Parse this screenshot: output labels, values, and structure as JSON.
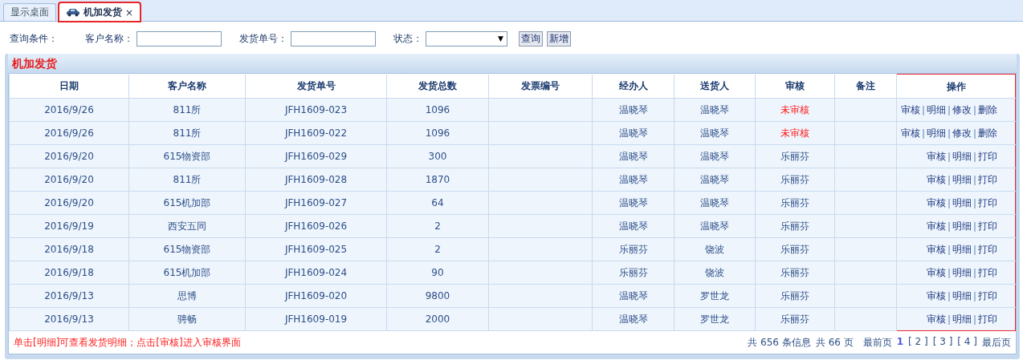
{
  "tabs": [
    {
      "label": "显示桌面",
      "selected": false,
      "closable": false,
      "icon": false,
      "highlighted": false
    },
    {
      "label": "机加发货",
      "selected": true,
      "closable": true,
      "icon": true,
      "highlighted": true
    }
  ],
  "close_glyph": "×",
  "filters": {
    "title": "查询条件：",
    "fields": [
      {
        "label": "客户名称：",
        "kind": "text"
      },
      {
        "label": "发货单号：",
        "kind": "text"
      },
      {
        "label": "状态：",
        "kind": "select"
      }
    ],
    "select_arrow": "▼",
    "buttons": [
      "查询",
      "新增"
    ]
  },
  "panel": {
    "title": "机加发货",
    "columns": [
      {
        "label": "日期",
        "highlighted": false
      },
      {
        "label": "客户名称",
        "highlighted": false
      },
      {
        "label": "发货单号",
        "highlighted": false
      },
      {
        "label": "发货总数",
        "highlighted": false
      },
      {
        "label": "发票编号",
        "highlighted": false
      },
      {
        "label": "经办人",
        "highlighted": false
      },
      {
        "label": "送货人",
        "highlighted": false
      },
      {
        "label": "审核",
        "highlighted": false
      },
      {
        "label": "备注",
        "highlighted": false
      },
      {
        "label": "操作",
        "highlighted": true
      }
    ],
    "rows": [
      {
        "date": "2016/9/26",
        "customer": "811所",
        "order": "JFH1609-023",
        "total": "1096",
        "handler": "温晓琴",
        "courier": "温晓琴",
        "review": "未审核",
        "approved": false,
        "actions": [
          "审核",
          "明细",
          "修改",
          "删除"
        ]
      },
      {
        "date": "2016/9/26",
        "customer": "811所",
        "order": "JFH1609-022",
        "total": "1096",
        "handler": "温晓琴",
        "courier": "温晓琴",
        "review": "未审核",
        "approved": false,
        "actions": [
          "审核",
          "明细",
          "修改",
          "删除"
        ]
      },
      {
        "date": "2016/9/20",
        "customer": "615物资部",
        "order": "JFH1609-029",
        "total": "300",
        "handler": "温晓琴",
        "courier": "温晓琴",
        "review": "乐丽芬",
        "approved": true,
        "actions": [
          "审核",
          "明细",
          "打印"
        ]
      },
      {
        "date": "2016/9/20",
        "customer": "811所",
        "order": "JFH1609-028",
        "total": "1870",
        "handler": "温晓琴",
        "courier": "温晓琴",
        "review": "乐丽芬",
        "approved": true,
        "actions": [
          "审核",
          "明细",
          "打印"
        ]
      },
      {
        "date": "2016/9/20",
        "customer": "615机加部",
        "order": "JFH1609-027",
        "total": "64",
        "handler": "温晓琴",
        "courier": "温晓琴",
        "review": "乐丽芬",
        "approved": true,
        "actions": [
          "审核",
          "明细",
          "打印"
        ]
      },
      {
        "date": "2016/9/19",
        "customer": "西安五同",
        "order": "JFH1609-026",
        "total": "2",
        "handler": "温晓琴",
        "courier": "温晓琴",
        "review": "乐丽芬",
        "approved": true,
        "actions": [
          "审核",
          "明细",
          "打印"
        ]
      },
      {
        "date": "2016/9/18",
        "customer": "615物资部",
        "order": "JFH1609-025",
        "total": "2",
        "handler": "乐丽芬",
        "courier": "饶波",
        "review": "乐丽芬",
        "approved": true,
        "actions": [
          "审核",
          "明细",
          "打印"
        ]
      },
      {
        "date": "2016/9/18",
        "customer": "615机加部",
        "order": "JFH1609-024",
        "total": "90",
        "handler": "乐丽芬",
        "courier": "饶波",
        "review": "乐丽芬",
        "approved": true,
        "actions": [
          "审核",
          "明细",
          "打印"
        ]
      },
      {
        "date": "2016/9/13",
        "customer": "思博",
        "order": "JFH1609-020",
        "total": "9800",
        "handler": "温晓琴",
        "courier": "罗世龙",
        "review": "乐丽芬",
        "approved": true,
        "actions": [
          "审核",
          "明细",
          "打印"
        ]
      },
      {
        "date": "2016/9/13",
        "customer": "骋畅",
        "order": "JFH1609-019",
        "total": "2000",
        "handler": "温晓琴",
        "courier": "罗世龙",
        "review": "乐丽芬",
        "approved": true,
        "actions": [
          "审核",
          "明细",
          "打印"
        ]
      }
    ],
    "hint": "单击[明细]可查看发货明细；点击[审核]进入审核界面",
    "summary": [
      "共 656 条信息",
      "共 66 页"
    ],
    "first": "最前页",
    "pages": [
      {
        "label": "1",
        "selected": true
      },
      {
        "label": "[ 2 ]",
        "selected": false
      },
      {
        "label": "[ 3 ]",
        "selected": false
      },
      {
        "label": "[ 4 ]",
        "selected": false
      }
    ],
    "last": "最后页"
  }
}
